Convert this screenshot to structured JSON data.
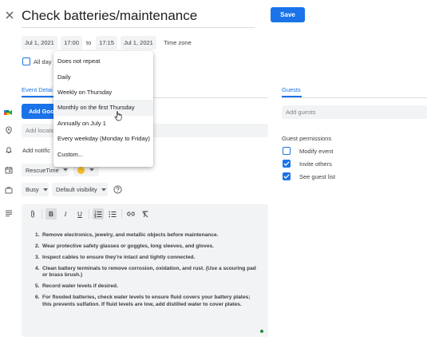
{
  "header": {
    "title": "Check batteries/maintenance",
    "save_label": "Save"
  },
  "datetime": {
    "start_date": "Jul 1, 2021",
    "start_time": "17:00",
    "to_label": "to",
    "end_time": "17:15",
    "end_date": "Jul 1, 2021",
    "timezone_label": "Time zone",
    "all_day_label": "All day"
  },
  "repeat_menu": {
    "items": [
      "Does not repeat",
      "Daily",
      "Weekly on Thursday",
      "Monthly on the first Thursday",
      "Annually on July 1",
      "Every weekday (Monday to Friday)",
      "Custom..."
    ],
    "hovered_index": 3
  },
  "tabs": {
    "event_details": "Event Detai"
  },
  "actions": {
    "add_meet": "Add Goo",
    "add_location_placeholder": "Add locatio",
    "add_notification": "Add notific"
  },
  "calendar": {
    "name": "RescueTime",
    "color": "#f6bf26"
  },
  "availability": {
    "busy_label": "Busy",
    "visibility_label": "Default visibility"
  },
  "guests": {
    "tab_label": "Guests",
    "add_placeholder": "Add guests",
    "permissions_title": "Guest permissions",
    "permissions": [
      {
        "label": "Modify event",
        "checked": false
      },
      {
        "label": "Invite others",
        "checked": true
      },
      {
        "label": "See guest list",
        "checked": true
      }
    ]
  },
  "description": {
    "items": [
      {
        "n": "1.",
        "text": "Remove electronics, jewelry, and metallic objects before maintenance."
      },
      {
        "n": "2.",
        "text": "Wear protective safety glasses or goggles, long sleeves, and gloves."
      },
      {
        "n": "3.",
        "text": "Inspect cables to ensure they're intact and tightly connected."
      },
      {
        "n": "4.",
        "text": "Clean battery terminals to remove corrosion, oxidation, and rust. (Use a scouring pad or brass brush.)"
      },
      {
        "n": "5.",
        "text": "Record water levels if desired."
      },
      {
        "n": "6.",
        "text": "For flooded batteries, check water levels to ensure fluid covers your battery plates; this prevents sulfation. If fluid levels are low, add distilled water to cover plates."
      }
    ]
  },
  "colors": {
    "accent": "#1a73e8",
    "chip_bg": "#f1f3f4",
    "text": "#3c4043"
  }
}
